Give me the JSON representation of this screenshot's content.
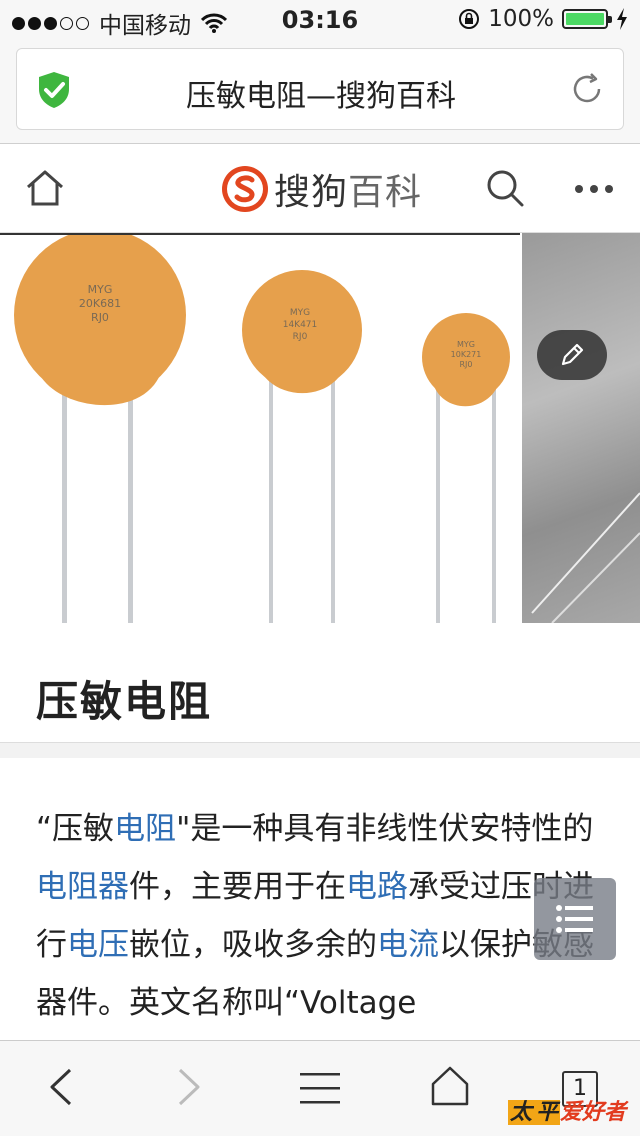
{
  "status_bar": {
    "carrier": "中国移动",
    "time": "03:16",
    "battery": "100%",
    "battery_level": 1.0
  },
  "address_bar": {
    "page_title": "压敏电阻—搜狗百科",
    "secure_icon": "shield-check-icon",
    "reload_icon": "reload-icon"
  },
  "site_header": {
    "logo_main": "搜狗",
    "logo_sub": "百科",
    "home_icon": "home-icon",
    "search_icon": "search-icon",
    "more_icon": "more-icon"
  },
  "hero": {
    "labels": [
      {
        "line1": "MYG",
        "line2": "20K681",
        "line3": "RJ0"
      },
      {
        "line1": "MYG",
        "line2": "14K471",
        "line3": "RJ0"
      },
      {
        "line1": "MYG",
        "line2": "10K271",
        "line3": "RJ0"
      }
    ],
    "edit_icon": "pencil-icon"
  },
  "entry": {
    "title": "压敏电阻",
    "intro_parts": [
      {
        "text": "“压敏",
        "link": false
      },
      {
        "text": "电阻",
        "link": true
      },
      {
        "text": "\"是一种具有非线性伏安特性的",
        "link": false
      },
      {
        "text": "电阻器",
        "link": true
      },
      {
        "text": "件，主要用于在",
        "link": false
      },
      {
        "text": "电路",
        "link": true
      },
      {
        "text": "承受过压时进行",
        "link": false
      },
      {
        "text": "电压",
        "link": true
      },
      {
        "text": "嵌位，吸收多余的",
        "link": false
      },
      {
        "text": "电流",
        "link": true
      },
      {
        "text": "以保护敏感器件。英文名称叫“Voltage",
        "link": false
      }
    ]
  },
  "toolbar": {
    "tab_count": "1",
    "back_icon": "back-icon",
    "forward_icon": "forward-icon",
    "menu_icon": "menu-icon",
    "home_icon": "home-icon"
  },
  "watermark": {
    "part1": "太",
    "part2": "平",
    "part3": "爱好者"
  },
  "colors": {
    "link": "#2f6eb5",
    "logo_red": "#e2461f",
    "shield_green": "#3fb63f",
    "varistor_orange": "#e6a04c"
  }
}
